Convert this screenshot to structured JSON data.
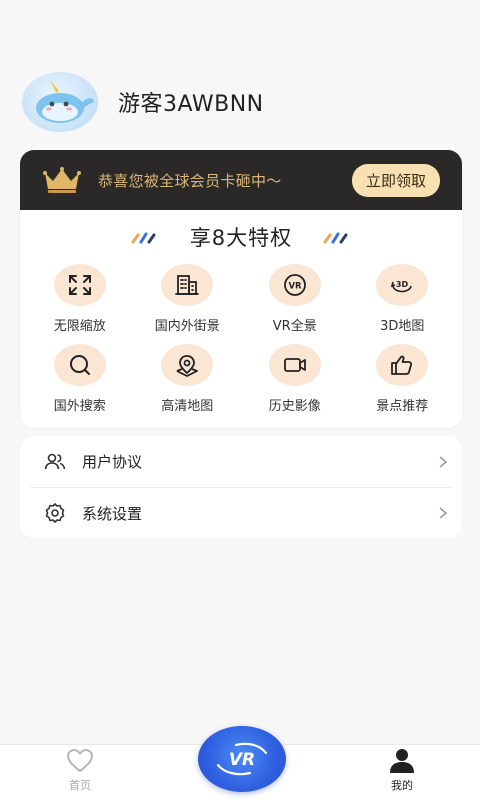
{
  "profile": {
    "username": "游客3AWBNN",
    "avatar_icon": "narwhal-avatar"
  },
  "vip": {
    "banner_text": "恭喜您被全球会员卡砸中～",
    "claim_label": "立即领取",
    "accent_color": "#d9b77a",
    "banner_bg": "#2a2927"
  },
  "privileges": {
    "title": "享8大特权",
    "items": [
      {
        "label": "无限缩放",
        "icon": "fullscreen-icon"
      },
      {
        "label": "国内外街景",
        "icon": "building-icon"
      },
      {
        "label": "VR全景",
        "icon": "vr-icon"
      },
      {
        "label": "3D地图",
        "icon": "3d-rotate-icon"
      },
      {
        "label": "国外搜索",
        "icon": "search-icon"
      },
      {
        "label": "高清地图",
        "icon": "map-pin-icon"
      },
      {
        "label": "历史影像",
        "icon": "video-icon"
      },
      {
        "label": "景点推荐",
        "icon": "thumbs-up-icon"
      }
    ]
  },
  "menu": {
    "items": [
      {
        "label": "用户协议",
        "icon": "users-icon"
      },
      {
        "label": "系统设置",
        "icon": "gear-icon"
      }
    ]
  },
  "tabbar": {
    "home_label": "首页",
    "center_label": "VR",
    "mine_label": "我的",
    "center_color": "#2f5fe0"
  }
}
